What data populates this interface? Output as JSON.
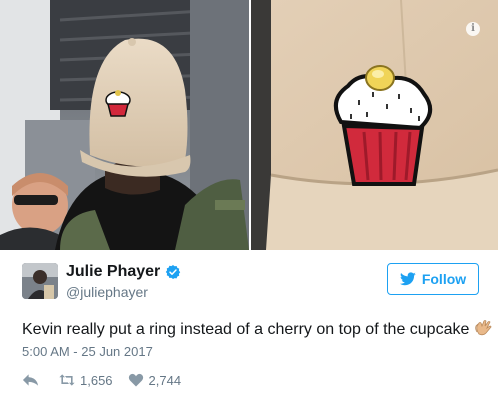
{
  "tweet": {
    "author": {
      "display_name": "Julie Phayer",
      "handle": "@juliephayer",
      "verified": true,
      "avatar": "avatar-photo"
    },
    "follow_button": {
      "label": "Follow",
      "icon": "twitter-bird-icon",
      "color": "#1da1f2"
    },
    "text": "Kevin really put a ring instead of a cherry on top of the cupcake",
    "emoji": "clapping-hands-icon",
    "timestamp": "5:00 AM - 25 Jun 2017",
    "actions": {
      "reply": {
        "icon": "reply-icon"
      },
      "retweets": {
        "icon": "retweet-icon",
        "count": "1,656"
      },
      "likes": {
        "icon": "heart-icon",
        "count": "2,744"
      }
    },
    "media": {
      "images": [
        "man-in-cupcake-cap-photo",
        "cupcake-cap-closeup-photo"
      ],
      "info_icon": "info-icon"
    }
  },
  "colors": {
    "text_primary": "#14171a",
    "text_secondary": "#657786",
    "accent": "#1da1f2"
  }
}
